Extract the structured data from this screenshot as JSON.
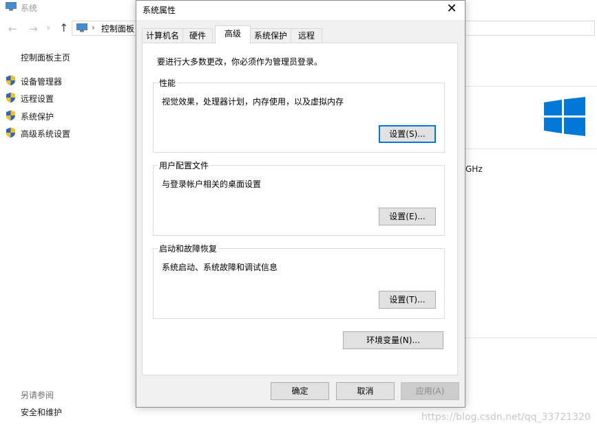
{
  "background_window": {
    "title": "系统",
    "address": "控制面板",
    "chevron": "›",
    "nav": {
      "back": "←",
      "forward": "→",
      "recent": "∨",
      "up": "↑"
    },
    "left_home": "控制面板主页",
    "left_items": [
      "设备管理器",
      "远程设置",
      "系统保护",
      "高级系统设置"
    ],
    "see_also_label": "另请参阅",
    "see_also_items": [
      "安全和维护"
    ],
    "partial_text": "GHz",
    "watermark": "https://blog.csdn.net/qq_33721320",
    "windows_logo_color": "#0078d7"
  },
  "dialog": {
    "title": "系统属性",
    "close_glyph": "✕",
    "tabs": [
      "计算机名",
      "硬件",
      "高级",
      "系统保护",
      "远程"
    ],
    "active_tab": "高级",
    "admin_note": "要进行大多数更改，你必须作为管理员登录。",
    "performance": {
      "title": "性能",
      "description": "视觉效果，处理器计划，内存使用，以及虚拟内存",
      "button": "设置(S)..."
    },
    "user_profiles": {
      "title": "用户配置文件",
      "description": "与登录帐户相关的桌面设置",
      "button": "设置(E)..."
    },
    "startup_recovery": {
      "title": "启动和故障恢复",
      "description": "系统启动、系统故障和调试信息",
      "button": "设置(T)..."
    },
    "env_button": "环境变量(N)...",
    "ok_button": "确定",
    "cancel_button": "取消",
    "apply_button": "应用(A)",
    "focus_color": "#0078d7"
  }
}
